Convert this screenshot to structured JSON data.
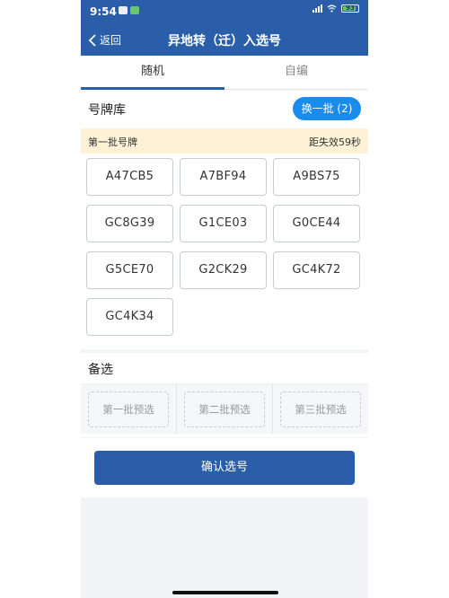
{
  "status_bar": {
    "time": "9:54",
    "battery": "93"
  },
  "nav": {
    "back_label": "返回",
    "title": "异地转（迁）入选号"
  },
  "tabs": [
    {
      "label": "随机"
    },
    {
      "label": "自编"
    }
  ],
  "pool": {
    "title": "号牌库",
    "refresh_label": "换一批 (2)",
    "batch_label": "第一批号牌",
    "timer_label": "距失效59秒",
    "plates": [
      "A47CB5",
      "A7BF94",
      "A9BS75",
      "GC8G39",
      "G1CE03",
      "G0CE44",
      "G5CE70",
      "G2CK29",
      "GC4K72",
      "GC4K34"
    ]
  },
  "backup": {
    "title": "备选",
    "slots": [
      "第一批预选",
      "第二批预选",
      "第三批预选"
    ]
  },
  "confirm_label": "确认选号",
  "colors": {
    "primary": "#2a5ea8",
    "accent": "#1a8cf0",
    "banner": "#fdf2d5"
  }
}
